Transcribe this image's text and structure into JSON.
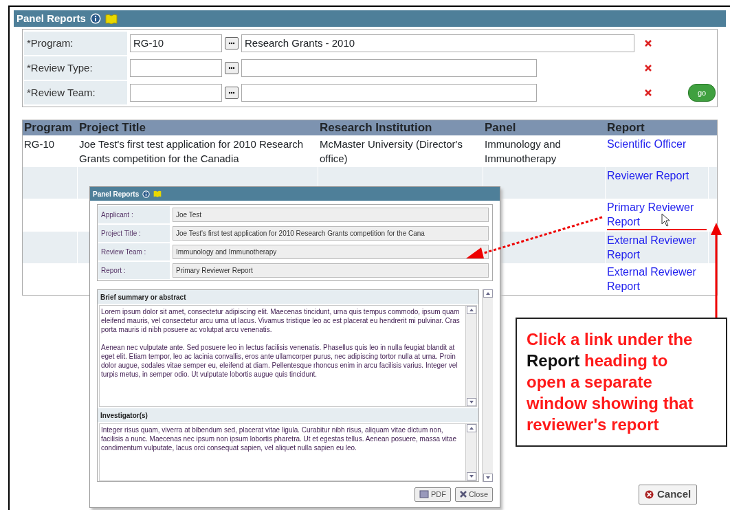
{
  "header": {
    "title": "Panel Reports"
  },
  "filters": [
    {
      "label": "*Program:",
      "code": "RG-10",
      "description": "Research Grants - 2010",
      "go": false
    },
    {
      "label": "*Review Type:",
      "go": false
    },
    {
      "label": "*Review Team:",
      "go": true
    }
  ],
  "go_button": "go",
  "table": {
    "columns": [
      "Program",
      "Project Title",
      "Research Institution",
      "Panel",
      "Report"
    ],
    "rows": [
      {
        "program": "RG-10",
        "project_title": "Joe Test's first test application for 2010 Research Grants competition for the Canadia",
        "institution": "McMaster University (Director's office)",
        "panel": "Immunology and Immunotherapy",
        "report": "Scientific Officer",
        "highlighted": false
      },
      {
        "report": "Reviewer Report",
        "highlighted": false
      },
      {
        "report": "Primary Reviewer Report",
        "highlighted": true
      },
      {
        "report": "External Reviewer Report",
        "highlighted": false
      },
      {
        "report": "External Reviewer Report",
        "highlighted": false
      }
    ]
  },
  "popup": {
    "title": "Panel Reports",
    "fields": [
      {
        "label": "Applicant :",
        "value": "Joe Test"
      },
      {
        "label": "Project Title :",
        "value": "Joe Test's first test application for 2010 Research Grants competition for the Cana"
      },
      {
        "label": "Review Team :",
        "value": "Immunology and Immunotherapy"
      },
      {
        "label": "Report :",
        "value": "Primary Reviewer Report"
      }
    ],
    "sections": [
      {
        "heading": "Brief summary or abstract",
        "paragraphs": [
          "Lorem ipsum dolor sit amet, consectetur adipiscing elit. Maecenas tincidunt, urna quis tempus commodo, ipsum quam eleifend mauris, vel consectetur arcu urna ut lacus. Vivamus tristique leo ac est placerat eu hendrerit mi pulvinar. Cras porta mauris id nibh posuere ac volutpat arcu venenatis.",
          "Aenean nec vulputate ante. Sed posuere leo in lectus facilisis venenatis. Phasellus quis leo in nulla feugiat blandit at eget elit. Etiam tempor, leo ac lacinia convallis, eros ante ullamcorper purus, nec adipiscing tortor nulla at urna. Proin dolor augue, sodales vitae semper eu, eleifend at diam. Pellentesque rhoncus enim in arcu facilisis varius. Integer vel turpis metus, in semper odio. Ut vulputate lobortis augue quis tincidunt."
        ]
      },
      {
        "heading": "Investigator(s)",
        "paragraphs": [
          "Integer risus quam, viverra at bibendum sed, placerat vitae ligula. Curabitur nibh risus, aliquam vitae dictum non, facilisis a nunc. Maecenas nec ipsum non ipsum lobortis pharetra. Ut et egestas tellus. Aenean posuere, massa vitae condimentum vulputate, lacus orci consequat sapien, vel aliquet nulla sapien eu leo."
        ]
      }
    ],
    "buttons": [
      "PDF",
      "Close"
    ]
  },
  "callout": {
    "text": "Click a link under the **Report** heading to open a separate window showing that reviewer's report"
  },
  "cancel_button": "Cancel"
}
